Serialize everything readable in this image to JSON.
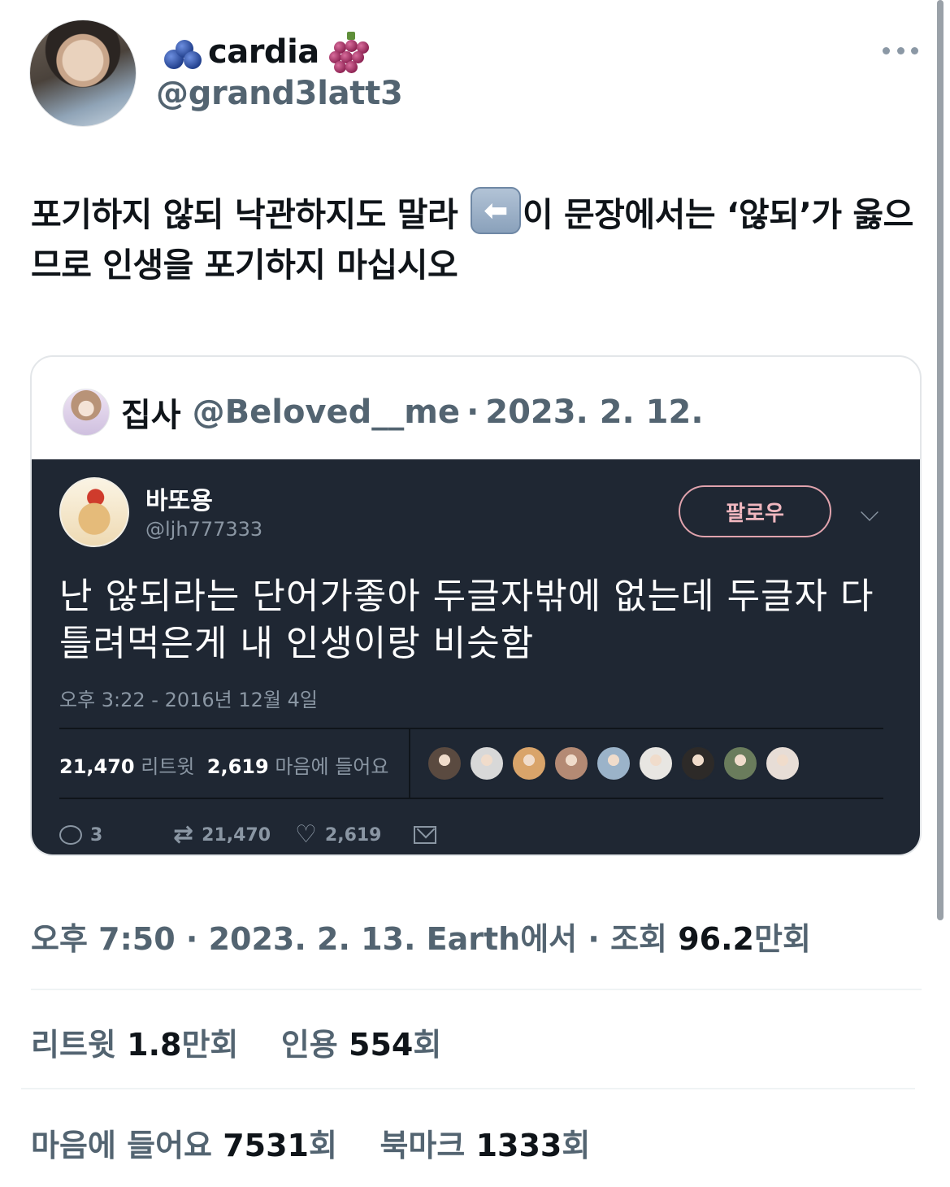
{
  "author": {
    "display_name": "cardia",
    "handle": "@grand3latt3",
    "name_emoji_left": "blueberries-emoji",
    "name_emoji_right": "grapes-emoji"
  },
  "tweet": {
    "text_part1": "포기하지 않되 낙관하지도 말라 ",
    "arrow_emoji": "left-arrow-emoji",
    "text_part2": "이 문장에서는 ‘않되’가 옳으므로 인생을 포기하지 마십시오"
  },
  "quote": {
    "author_name": "집사",
    "author_handle": "@Beloved__me",
    "separator": "·",
    "date": "2023. 2. 12.",
    "embedded": {
      "name": "바또용",
      "handle": "@ljh777333",
      "follow_label": "팔로우",
      "text": "난 않되라는 단어가좋아 두글자밖에 없는데 두글자 다 틀려먹은게 내 인생이랑 비슷함",
      "time": "오후 3:22 - 2016년 12월 4일",
      "retweet_count": "21,470",
      "retweet_label": "리트윗",
      "likes_count": "2,619",
      "likes_label": "마음에 들어요",
      "liker_colors": [
        "#5a4a40",
        "#d8d8d8",
        "#d9a46a",
        "#b48a74",
        "#9bb3c9",
        "#e8e6e2",
        "#2d2a28",
        "#6a7c5c",
        "#e7ddd6"
      ],
      "actions": {
        "reply_count": "3",
        "retweet_count": "21,470",
        "like_count": "2,619"
      }
    }
  },
  "meta": {
    "time": "오후 7:50",
    "sep1": " · ",
    "date": "2023. 2. 13.",
    "source": " Earth에서",
    "sep2": " · ",
    "views_label": "조회 ",
    "views_value": "96.2",
    "views_unit": "만회"
  },
  "stats": {
    "retweets_label": "리트윗 ",
    "retweets_value": "1.8",
    "retweets_unit": "만회",
    "quotes_label": "인용 ",
    "quotes_value": "554",
    "quotes_unit": "회",
    "likes_label": "마음에 들어요 ",
    "likes_value": "7531",
    "likes_unit": "회",
    "bookmarks_label": "북마크 ",
    "bookmarks_value": "1333",
    "bookmarks_unit": "회"
  }
}
